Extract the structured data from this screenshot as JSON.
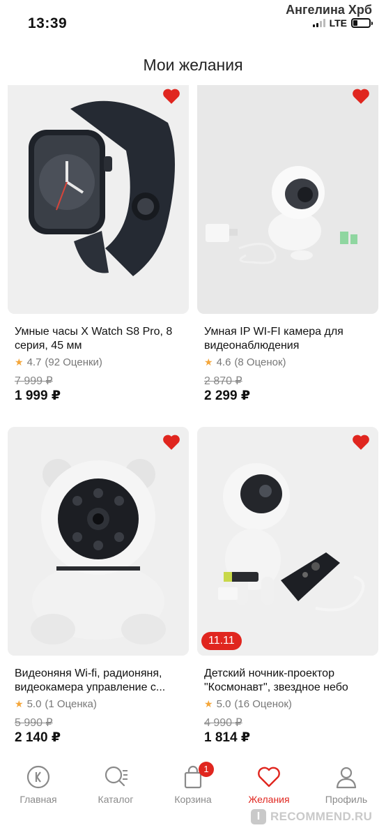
{
  "status_bar": {
    "time": "13:39",
    "carrier": "Ангелина Хрб",
    "network": "LTE",
    "signal_bars": 4,
    "signal_active": 2,
    "battery_level": 0.25
  },
  "header": {
    "title": "Мои желания"
  },
  "products": [
    {
      "title": "Умные часы X Watch S8 Pro, 8 серия, 45 мм",
      "rating": "4.7",
      "reviews": "(92 Оценки)",
      "old_price": "7 999 ₽",
      "price": "1 999 ₽",
      "in_wishlist": true,
      "promo": ""
    },
    {
      "title": "Умная IP WI-FI камера для видеонаблюдения",
      "rating": "4.6",
      "reviews": "(8 Оценок)",
      "old_price": "2 870 ₽",
      "price": "2 299 ₽",
      "in_wishlist": true,
      "promo": ""
    },
    {
      "title": "Видеоняня Wi-fi, радионяня, видеокамера управление с...",
      "rating": "5.0",
      "reviews": "(1 Оценка)",
      "old_price": "5 990 ₽",
      "price": "2 140 ₽",
      "in_wishlist": true,
      "promo": ""
    },
    {
      "title": "Детский ночник-проектор \"Космонавт\", звездное небо",
      "rating": "5.0",
      "reviews": "(16 Оценок)",
      "old_price": "4 990 ₽",
      "price": "1 814 ₽",
      "in_wishlist": true,
      "promo": "11.11"
    }
  ],
  "tabbar": {
    "items": [
      {
        "label": "Главная",
        "icon": "home-logo-icon"
      },
      {
        "label": "Каталог",
        "icon": "catalog-search-icon"
      },
      {
        "label": "Корзина",
        "icon": "cart-bag-icon",
        "badge": "1"
      },
      {
        "label": "Желания",
        "icon": "heart-icon",
        "active": true
      },
      {
        "label": "Профиль",
        "icon": "profile-icon"
      }
    ]
  },
  "watermark": {
    "logo": "I",
    "text": "RECOMMEND.RU"
  },
  "colors": {
    "accent": "#e0261f",
    "star": "#f4a63a",
    "card_bg": "#efefef",
    "inactive": "#8a8a8a"
  }
}
